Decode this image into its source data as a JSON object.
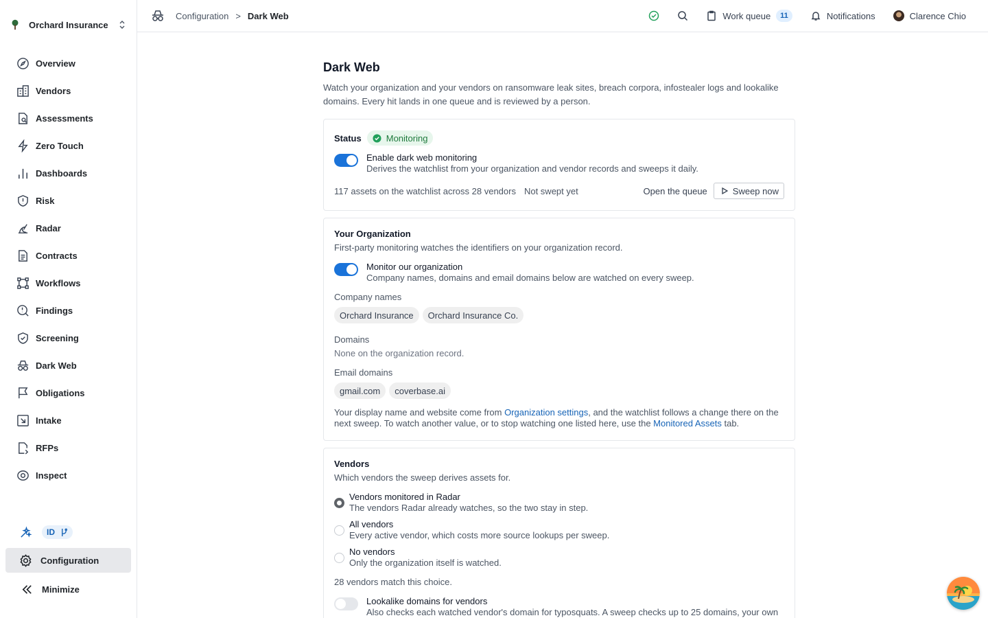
{
  "org": {
    "name": "Orchard Insurance"
  },
  "nav": [
    {
      "label": "Overview",
      "icon": "compass-icon"
    },
    {
      "label": "Vendors",
      "icon": "building-icon"
    },
    {
      "label": "Assessments",
      "icon": "document-search-icon"
    },
    {
      "label": "Zero Touch",
      "icon": "lightning-icon"
    },
    {
      "label": "Dashboards",
      "icon": "bar-chart-icon"
    },
    {
      "label": "Risk",
      "icon": "shield-alert-icon"
    },
    {
      "label": "Radar",
      "icon": "radar-icon"
    },
    {
      "label": "Contracts",
      "icon": "contract-icon"
    },
    {
      "label": "Workflows",
      "icon": "workflow-icon"
    },
    {
      "label": "Findings",
      "icon": "magnifier-alert-icon"
    },
    {
      "label": "Screening",
      "icon": "shield-check-icon"
    },
    {
      "label": "Dark Web",
      "icon": "incognito-icon"
    },
    {
      "label": "Obligations",
      "icon": "flag-icon"
    },
    {
      "label": "Intake",
      "icon": "inbox-arrow-icon"
    },
    {
      "label": "RFPs",
      "icon": "document-pen-icon"
    },
    {
      "label": "Inspect",
      "icon": "eye-icon"
    }
  ],
  "sidebar_footer": {
    "id_badge": "ID",
    "configuration": "Configuration",
    "minimize": "Minimize"
  },
  "breadcrumb": {
    "parent": "Configuration",
    "separator": ">",
    "current": "Dark Web"
  },
  "topbar": {
    "work_queue": "Work queue",
    "work_queue_count": "11",
    "notifications": "Notifications",
    "user": "Clarence Chio"
  },
  "page": {
    "title": "Dark Web",
    "description": "Watch your organization and your vendors on ransomware leak sites, breach corpora, infostealer logs and lookalike domains. Every hit lands in one queue and is reviewed by a person."
  },
  "status_card": {
    "status_label": "Status",
    "status_value": "Monitoring",
    "toggle_title": "Enable dark web monitoring",
    "toggle_sub": "Derives the watchlist from your organization and vendor records and sweeps it daily.",
    "toggle_on": true,
    "watchlist_info": "117 assets on the watchlist across 28 vendors",
    "sweep_info": "Not swept yet",
    "open_queue": "Open the queue",
    "sweep_now": "Sweep now"
  },
  "org_card": {
    "title": "Your Organization",
    "subtitle": "First-party monitoring watches the identifiers on your organization record.",
    "toggle_title": "Monitor our organization",
    "toggle_sub": "Company names, domains and email domains below are watched on every sweep.",
    "company_names_label": "Company names",
    "company_names": [
      "Orchard Insurance",
      "Orchard Insurance Co."
    ],
    "domains_label": "Domains",
    "domains_empty": "None on the organization record.",
    "email_domains_label": "Email domains",
    "email_domains": [
      "gmail.com",
      "coverbase.ai"
    ],
    "note_1": "Your display name and website come from ",
    "note_link_1": "Organization settings",
    "note_2": ", and the watchlist follows a change there on the next sweep. To watch another value, or to stop watching one listed here, use the ",
    "note_link_2": "Monitored Assets",
    "note_3": " tab."
  },
  "vendors_card": {
    "title": "Vendors",
    "subtitle": "Which vendors the sweep derives assets for.",
    "options": [
      {
        "title": "Vendors monitored in Radar",
        "sub": "The vendors Radar already watches, so the two stay in step.",
        "selected": true
      },
      {
        "title": "All vendors",
        "sub": "Every active vendor, which costs more source lookups per sweep.",
        "selected": false
      },
      {
        "title": "No vendors",
        "sub": "Only the organization itself is watched.",
        "selected": false
      }
    ],
    "match_count": "28 vendors match this choice.",
    "lookalike_title": "Lookalike domains for vendors",
    "lookalike_sub": "Also checks each watched vendor's domain for typosquats. A sweep checks up to 25 domains, your own",
    "lookalike_on": false
  },
  "colors": {
    "accent": "#1a73d9",
    "link": "#1663b6",
    "success": "#1e7a3c"
  }
}
